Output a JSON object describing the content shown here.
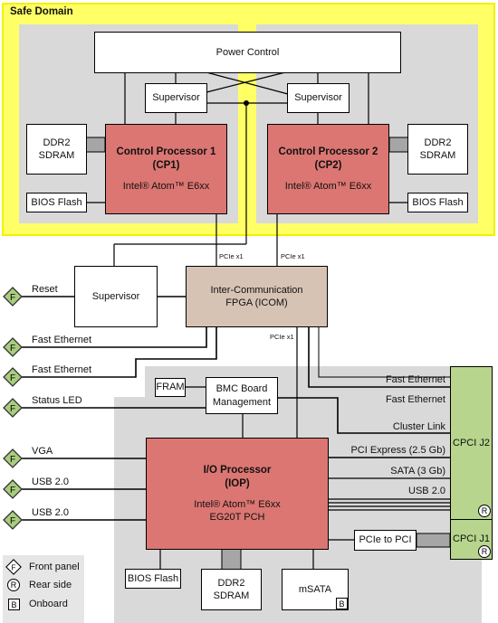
{
  "safe_domain": {
    "title": "Safe Domain"
  },
  "blocks": {
    "power_control": "Power Control",
    "supervisor_1": "Supervisor",
    "supervisor_2": "Supervisor",
    "supervisor_main": "Supervisor",
    "cp1": {
      "title_1": "Control Processor 1",
      "title_2": "(CP1)",
      "subtitle": "Intel® Atom™ E6xx"
    },
    "cp2": {
      "title_1": "Control Processor 2",
      "title_2": "(CP2)",
      "subtitle": "Intel® Atom™ E6xx"
    },
    "ddr_cp1": {
      "line1": "DDR2",
      "line2": "SDRAM"
    },
    "ddr_cp2": {
      "line1": "DDR2",
      "line2": "SDRAM"
    },
    "bios_cp1": "BIOS Flash",
    "bios_cp2": "BIOS Flash",
    "icom": {
      "line1": "Inter-Communication",
      "line2": "FPGA (ICOM)"
    },
    "fram": "FRAM",
    "bmc": {
      "line1": "BMC Board",
      "line2": "Management"
    },
    "iop": {
      "title_1": "I/O Processor",
      "title_2": "(IOP)",
      "sub_1": "Intel® Atom™ E6xx",
      "sub_2": "EG20T PCH"
    },
    "bios_iop": "BIOS Flash",
    "ddr_iop": {
      "line1": "DDR2",
      "line2": "SDRAM"
    },
    "msata": "mSATA",
    "msata_badge": "B",
    "pcie_to_pci": "PCIe to PCI",
    "cpci_j2": "CPCI J2",
    "cpci_j1": "CPCI J1",
    "rear_badge": "R"
  },
  "bus_labels": {
    "pcie_cp1": "PCIe x1",
    "pcie_cp2": "PCIe x1",
    "pcie_iop": "PCIe x1"
  },
  "front_panel": [
    {
      "badge": "F",
      "label": "Reset"
    },
    {
      "badge": "F",
      "label": "Fast Ethernet"
    },
    {
      "badge": "F",
      "label": "Fast Ethernet"
    },
    {
      "badge": "F",
      "label": "Status LED"
    },
    {
      "badge": "F",
      "label": "VGA"
    },
    {
      "badge": "F",
      "label": "USB 2.0"
    },
    {
      "badge": "F",
      "label": "USB 2.0"
    }
  ],
  "rear_links": [
    "Fast Ethernet",
    "Fast Ethernet",
    "Cluster Link",
    "PCI Express (2.5 Gb)",
    "SATA (3 Gb)",
    "USB 2.0"
  ],
  "legend": [
    {
      "symbol": "F",
      "label": "Front panel"
    },
    {
      "symbol": "R",
      "label": "Rear side"
    },
    {
      "symbol": "B",
      "label": "Onboard"
    }
  ],
  "colors": {
    "safe_domain": "#ffff66",
    "processor": "#dc7672",
    "fpga": "#d7c3b4",
    "connector": "#b7d58c",
    "board_area": "#d9d9d9"
  }
}
